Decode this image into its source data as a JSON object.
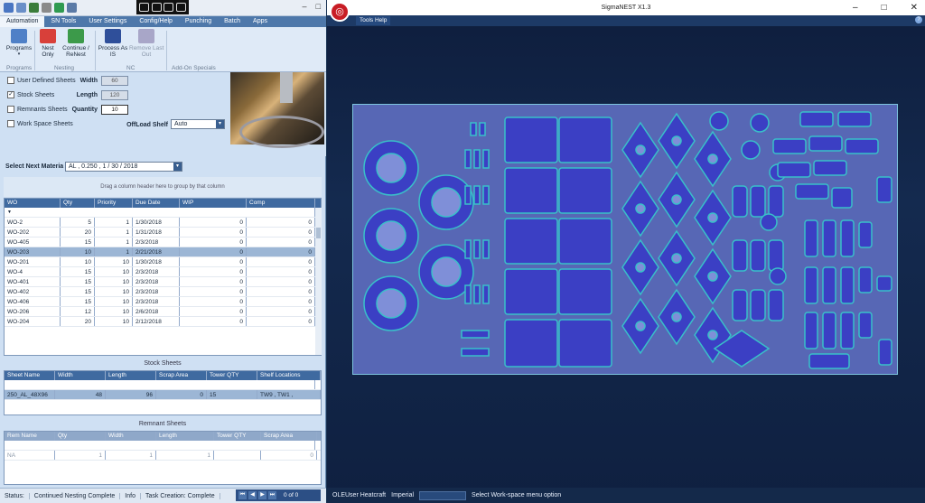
{
  "left": {
    "menu_tabs": [
      "Automation",
      "SN Tools",
      "User Settings",
      "Config/Help",
      "Punching",
      "Batch",
      "Apps"
    ],
    "ribbon": {
      "buttons": [
        {
          "label": "Programs",
          "icon": "programs-icon"
        },
        {
          "label": "Nest\nOnly",
          "icon": "nest-only-icon"
        },
        {
          "label": "Continue /\nReNest",
          "icon": "continue-renest-icon"
        },
        {
          "label": "Process As\nIS",
          "icon": "process-as-is-icon"
        },
        {
          "label": "Remove Last\nOut",
          "icon": "remove-last-out-icon",
          "disabled": true
        }
      ],
      "groups": [
        "Programs",
        "Nesting",
        "NC",
        "Add-On Specials"
      ]
    },
    "sheet_options": {
      "user_defined": {
        "label": "User Defined Sheets",
        "checked": false
      },
      "stock": {
        "label": "Stock Sheets",
        "checked": true
      },
      "remnants": {
        "label": "Remnants Sheets",
        "checked": false
      },
      "workspace": {
        "label": "Work Space Sheets",
        "checked": false
      }
    },
    "fields": {
      "width": {
        "label": "Width",
        "value": "60"
      },
      "length": {
        "label": "Length",
        "value": "120"
      },
      "quantity": {
        "label": "Quantity",
        "value": "10"
      }
    },
    "offload": {
      "label": "OffLoad Shelf",
      "value": "Auto"
    },
    "next_material": {
      "label": "Select Next Materia",
      "value": "AL ,  0.250 , 1 / 30 / 2018"
    },
    "drag_hint": "Drag a column header here to group by that column",
    "wo_grid": {
      "columns": [
        "WO",
        "Qty",
        "Priority",
        "Due Date",
        "WIP",
        "Comp"
      ],
      "rows": [
        [
          "WO-2",
          "5",
          "1",
          "1/30/2018",
          "0",
          "0"
        ],
        [
          "WO-202",
          "20",
          "1",
          "1/31/2018",
          "0",
          "0"
        ],
        [
          "WO-405",
          "15",
          "1",
          "2/3/2018",
          "0",
          "0"
        ],
        [
          "WO-203",
          "10",
          "1",
          "2/21/2018",
          "0",
          "0"
        ],
        [
          "WO-201",
          "10",
          "10",
          "1/30/2018",
          "0",
          "0"
        ],
        [
          "WO-4",
          "15",
          "10",
          "2/3/2018",
          "0",
          "0"
        ],
        [
          "WO-401",
          "15",
          "10",
          "2/3/2018",
          "0",
          "0"
        ],
        [
          "WO-402",
          "15",
          "10",
          "2/3/2018",
          "0",
          "0"
        ],
        [
          "WO-406",
          "15",
          "10",
          "2/3/2018",
          "0",
          "0"
        ],
        [
          "WO-206",
          "12",
          "10",
          "2/6/2018",
          "0",
          "0"
        ],
        [
          "WO-204",
          "20",
          "10",
          "2/12/2018",
          "0",
          "0"
        ]
      ],
      "selected_index": 3
    },
    "stock_sheets": {
      "title": "Stock Sheets",
      "columns": [
        "Sheet Name",
        "Width",
        "Length",
        "Scrap Area",
        "Tower QTY",
        "Shelf Locations"
      ],
      "rows": [
        [
          "250_AL_48X96",
          "48",
          "96",
          "0",
          "15",
          "TW9 , TW1 ,"
        ]
      ]
    },
    "remnant_sheets": {
      "title": "Remnant Sheets",
      "columns": [
        "Rem Name",
        "Qty",
        "Width",
        "Length",
        "Tower QTY",
        "Scrap Area"
      ],
      "rows": [
        [
          "NA",
          "1",
          "1",
          "1",
          "",
          "0"
        ]
      ]
    },
    "status": [
      "Status:",
      "Continued Nesting Complete",
      "Info",
      "Task Creation: Complete"
    ],
    "pager": "0 of 0"
  },
  "right": {
    "title": "SigmaNEST X1.3",
    "menu": "Tools Help",
    "status": {
      "user": "OLEUser Heatcraft",
      "units": "Imperial",
      "hint": "Select Work-space menu option"
    }
  }
}
